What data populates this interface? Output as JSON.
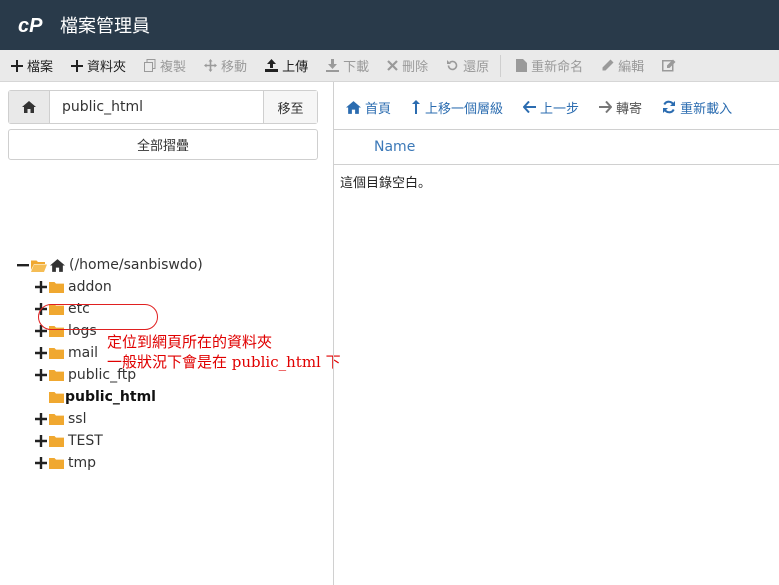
{
  "app": {
    "title": "檔案管理員",
    "logo_text": "cP"
  },
  "toolbar": {
    "items": [
      {
        "label": "檔案",
        "icon": "plus-icon",
        "enabled": true
      },
      {
        "label": "資料夾",
        "icon": "plus-icon",
        "enabled": true
      },
      {
        "label": "複製",
        "icon": "copy-icon",
        "enabled": false
      },
      {
        "label": "移動",
        "icon": "move-icon",
        "enabled": false
      },
      {
        "label": "上傳",
        "icon": "upload-icon",
        "enabled": true
      },
      {
        "label": "下載",
        "icon": "download-icon",
        "enabled": false
      },
      {
        "label": "刪除",
        "icon": "delete-icon",
        "enabled": false
      },
      {
        "label": "還原",
        "icon": "restore-icon",
        "enabled": false
      },
      {
        "label": "重新命名",
        "icon": "file-icon",
        "enabled": false
      },
      {
        "label": "編輯",
        "icon": "pencil-icon",
        "enabled": false
      }
    ]
  },
  "path_bar": {
    "value": "public_html",
    "go_label": "移至"
  },
  "collapse_all_label": "全部摺疊",
  "tree": {
    "root_label": "(/home/sanbiswdo)",
    "items": [
      {
        "label": "addon",
        "expandable": true
      },
      {
        "label": "etc",
        "expandable": true
      },
      {
        "label": "logs",
        "expandable": true
      },
      {
        "label": "mail",
        "expandable": true
      },
      {
        "label": "public_ftp",
        "expandable": true
      },
      {
        "label": "public_html",
        "expandable": false,
        "selected": true
      },
      {
        "label": "ssl",
        "expandable": true
      },
      {
        "label": "TEST",
        "expandable": true
      },
      {
        "label": "tmp",
        "expandable": true
      }
    ]
  },
  "annotation": {
    "line1": "定位到網頁所在的資料夾",
    "line2": "一般狀況下會是在 public_html 下"
  },
  "nav": {
    "home": "首頁",
    "up_one_level": "上移一個層級",
    "back": "上一步",
    "forward": "轉寄",
    "reload": "重新載入"
  },
  "file_list": {
    "column_name": "Name",
    "empty_message": "這個目錄空白。"
  },
  "colors": {
    "header_bg": "#293a4a",
    "folder": "#f0a830",
    "link": "#2b6cb0",
    "annotation": "#e00000"
  }
}
